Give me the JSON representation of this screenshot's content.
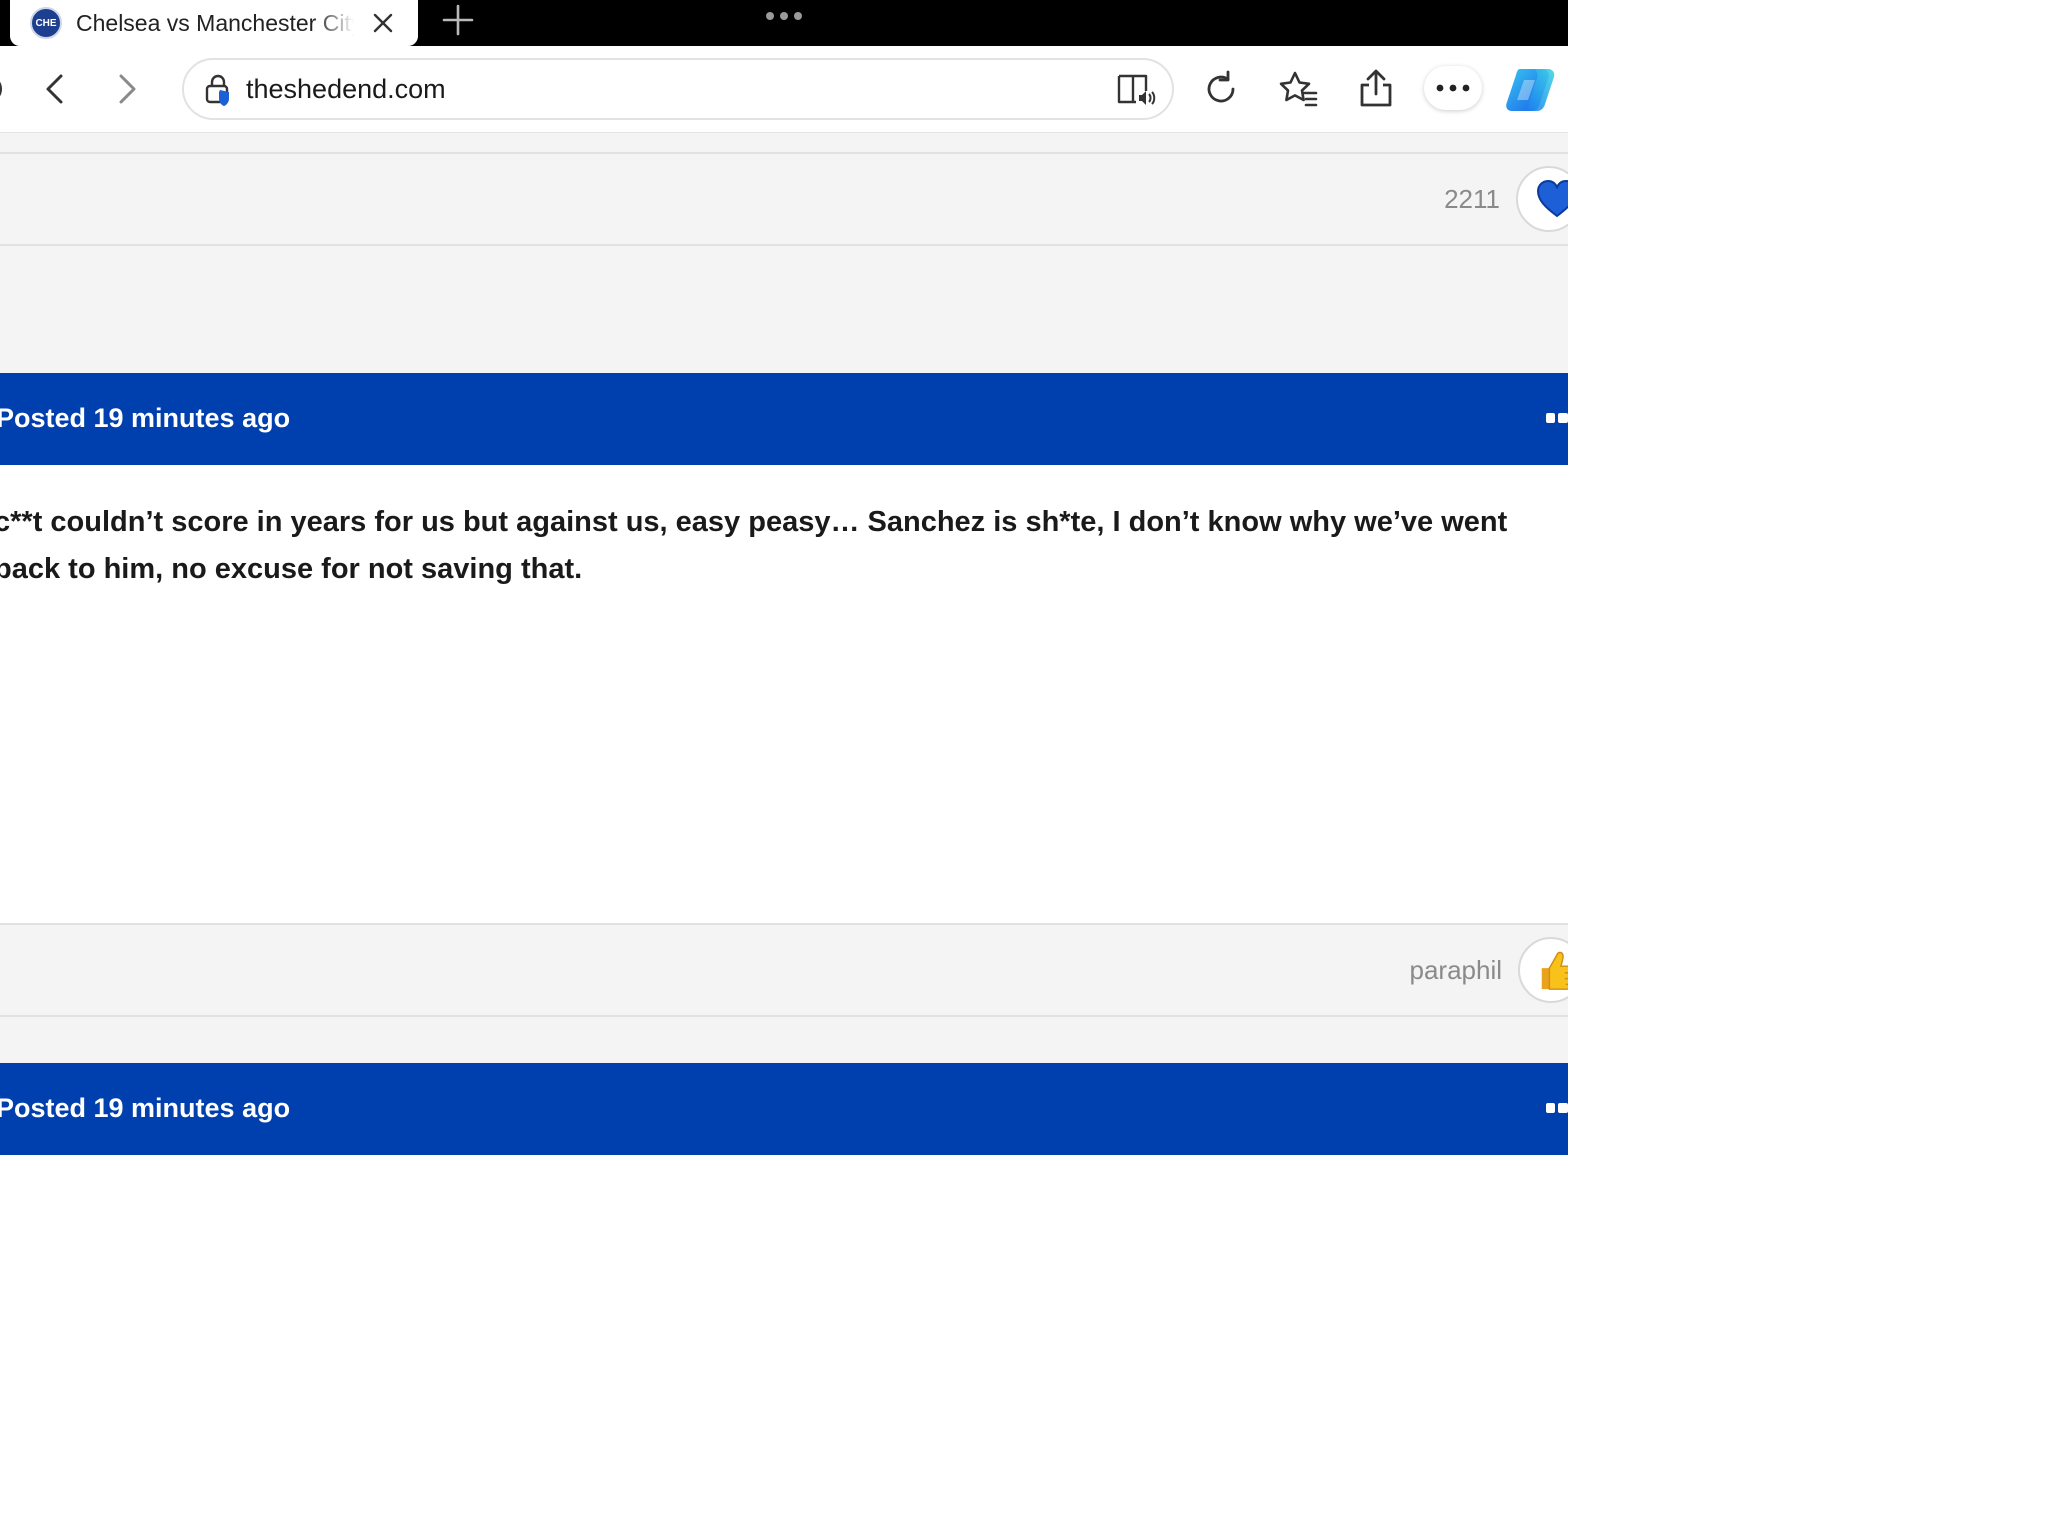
{
  "browser": {
    "tab": {
      "title": "Chelsea vs Manchester City",
      "favicon_text": "CHE"
    },
    "address": {
      "url": "theshedend.com"
    }
  },
  "posts": [
    {
      "footer_count": "2211",
      "footer_reaction": "heart-icon"
    },
    {
      "posted": "Posted 19 minutes ago",
      "body": "c**t couldn’t score in years for us but against us, easy peasy… Sanchez is sh*te, I don’t know why we’ve went back to him, no excuse for not saving that.",
      "footer_user": "paraphil",
      "footer_reaction": "thumbs-up-icon"
    },
    {
      "posted": "Posted 19 minutes ago"
    }
  ],
  "colors": {
    "header_blue": "#003fae",
    "heart_blue": "#1d5fd6",
    "copilot_blue": "#1a7ef0"
  }
}
